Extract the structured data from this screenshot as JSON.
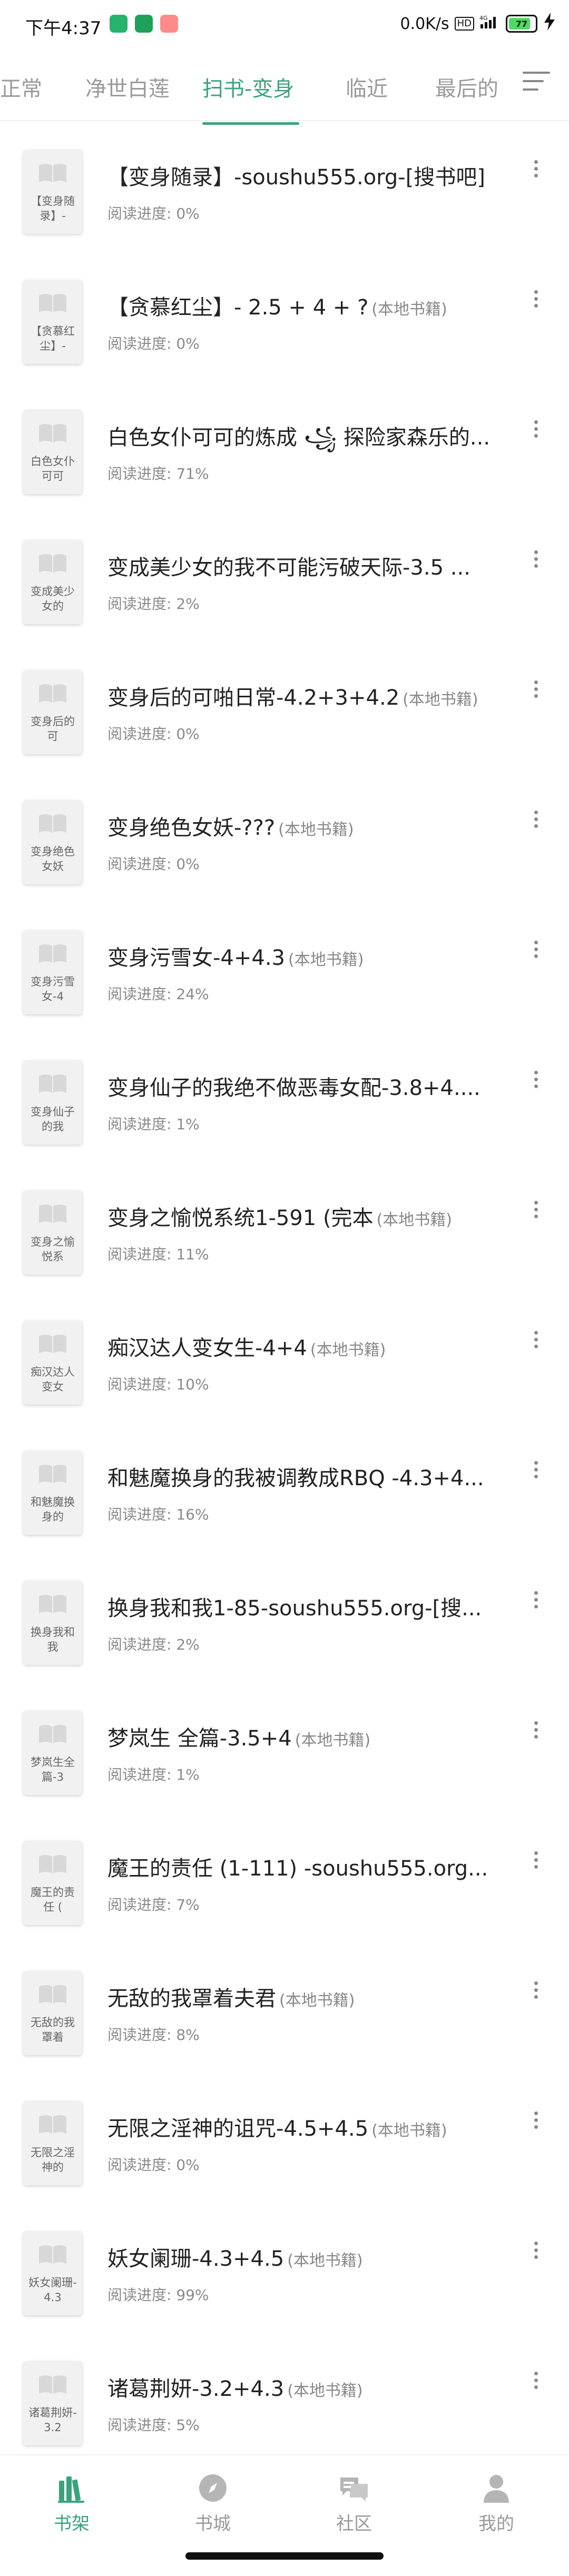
{
  "status_bar": {
    "time": "下午4:37",
    "network_speed": "0.0K/s",
    "hd_label": "HD",
    "network_type": "4G",
    "battery_level": "77",
    "colors": {
      "app1": "#27b36b",
      "app2": "#1fa15a",
      "app3": "#ff6b6b"
    }
  },
  "tabs": [
    {
      "label": "正常",
      "active": false
    },
    {
      "label": "净世白莲",
      "active": false
    },
    {
      "label": "扫书-变身",
      "active": true
    },
    {
      "label": "临近",
      "active": false
    },
    {
      "label": "最后的",
      "active": false
    }
  ],
  "accent_color": "#3aa37c",
  "books": [
    {
      "cover_text": "【变身随录】-",
      "title": "【变身随录】-soushu555.org-[搜书吧]",
      "tag": "",
      "progress": "阅读进度: 0%"
    },
    {
      "cover_text": "【贪慕红尘】-",
      "title": "【贪慕红尘】- 2.5 + 4 + ?",
      "tag": "(本地书籍)",
      "progress": "阅读进度: 0%"
    },
    {
      "cover_text": "白色女仆可可",
      "title": "白色女仆可可的炼成 ꧁ 探险家森乐的...",
      "tag": "",
      "progress": "阅读进度: 71%"
    },
    {
      "cover_text": "变成美少女的",
      "title": "变成美少女的我不可能污破天际-3.5 ...",
      "tag": "",
      "progress": "阅读进度: 2%"
    },
    {
      "cover_text": "变身后的可",
      "title": "变身后的可啪日常-4.2+3+4.2",
      "tag": "(本地书籍)",
      "progress": "阅读进度: 0%"
    },
    {
      "cover_text": "变身绝色女妖",
      "title": "变身绝色女妖-???",
      "tag": "(本地书籍)",
      "progress": "阅读进度: 0%"
    },
    {
      "cover_text": "变身污雪女-4",
      "title": "变身污雪女-4+4.3",
      "tag": "(本地书籍)",
      "progress": "阅读进度: 24%"
    },
    {
      "cover_text": "变身仙子的我",
      "title": "变身仙子的我绝不做恶毒女配-3.8+4....",
      "tag": "",
      "progress": "阅读进度: 1%"
    },
    {
      "cover_text": "变身之愉悦系",
      "title": "变身之愉悦系统1-591 (完本",
      "tag": "(本地书籍)",
      "progress": "阅读进度: 11%"
    },
    {
      "cover_text": "痴汉达人变女",
      "title": "痴汉达人变女生-4+4",
      "tag": "(本地书籍)",
      "progress": "阅读进度: 10%"
    },
    {
      "cover_text": "和魅魔换身的",
      "title": "和魅魔换身的我被调教成RBQ -4.3+4...",
      "tag": "",
      "progress": "阅读进度: 16%"
    },
    {
      "cover_text": "换身我和我",
      "title": "换身我和我1-85-soushu555.org-[搜...",
      "tag": "",
      "progress": "阅读进度: 2%"
    },
    {
      "cover_text": "梦岚生全篇-3",
      "title": "梦岚生 全篇-3.5+4",
      "tag": "(本地书籍)",
      "progress": "阅读进度: 1%"
    },
    {
      "cover_text": "魔王的责任 (",
      "title": "魔王的责任 (1-111) -soushu555.org...",
      "tag": "",
      "progress": "阅读进度: 7%"
    },
    {
      "cover_text": "无敌的我罩着",
      "title": "无敌的我罩着夫君",
      "tag": "(本地书籍)",
      "progress": "阅读进度: 8%"
    },
    {
      "cover_text": "无限之淫神的",
      "title": "无限之淫神的诅咒-4.5+4.5",
      "tag": "(本地书籍)",
      "progress": "阅读进度: 0%"
    },
    {
      "cover_text": "妖女阑珊-4.3",
      "title": "妖女阑珊-4.3+4.5",
      "tag": "(本地书籍)",
      "progress": "阅读进度: 99%"
    },
    {
      "cover_text": "诸葛荆妍-3.2",
      "title": "诸葛荆妍-3.2+4.3",
      "tag": "(本地书籍)",
      "progress": "阅读进度: 5%"
    }
  ],
  "bottom_nav": [
    {
      "label": "书架",
      "icon": "bookshelf-icon",
      "active": true
    },
    {
      "label": "书城",
      "icon": "compass-icon",
      "active": false
    },
    {
      "label": "社区",
      "icon": "chat-icon",
      "active": false
    },
    {
      "label": "我的",
      "icon": "person-icon",
      "active": false
    }
  ]
}
